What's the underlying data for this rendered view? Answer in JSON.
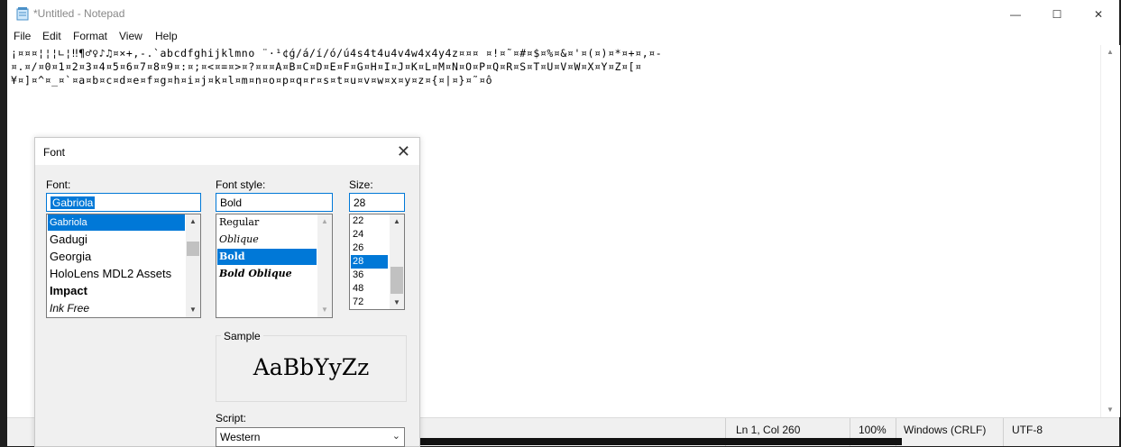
{
  "window": {
    "title": "*Untitled - Notepad",
    "buttons": {
      "minimize": "—",
      "maximize": "☐",
      "close": "✕"
    }
  },
  "menu": [
    "File",
    "Edit",
    "Format",
    "View",
    "Help"
  ],
  "editor": {
    "lines": [
      "¡¤¤¤¦¦¦∟¦‼¶♂♀♪♫¤×+,-.`abcdfghijklmno ¨·¹¢ǵ/á/í/ó/ú4s4t4u4v4w4x4y4z¤¤¤ ¤!¤˜¤#¤$¤%¤&¤'¤(¤)¤*¤+¤,¤-",
      "¤.¤/¤0¤1¤2¤3¤4¤5¤6¤7¤8¤9¤:¤;¤<¤=¤>¤?¤¤¤A¤B¤C¤D¤E¤F¤G¤H¤I¤J¤K¤L¤M¤N¤O¤P¤Q¤R¤S¤T¤U¤V¤W¤X¤Y¤Z¤[¤",
      "¥¤]¤^¤_¤`¤a¤b¤c¤d¤e¤f¤g¤h¤i¤j¤k¤l¤m¤n¤o¤p¤q¤r¤s¤t¤u¤v¤w¤x¤y¤z¤{¤|¤}¤˜¤ô"
    ]
  },
  "status": {
    "position": "Ln 1, Col 260",
    "zoom": "100%",
    "line_ending": "Windows (CRLF)",
    "encoding": "UTF-8"
  },
  "dialog": {
    "title": "Font",
    "font_label": "Font:",
    "font_value": "Gabriola",
    "fonts": [
      "Gabriola",
      "Gadugi",
      "Georgia",
      "HoloLens MDL2 Assets",
      "Impact",
      "Ink Free"
    ],
    "style_label": "Font style:",
    "style_value": "Bold",
    "styles": [
      "Regular",
      "Oblique",
      "Bold",
      "Bold Oblique"
    ],
    "size_label": "Size:",
    "size_value": "28",
    "sizes": [
      "22",
      "24",
      "26",
      "28",
      "36",
      "48",
      "72"
    ],
    "sample_label": "Sample",
    "sample_text": "AaBbYyZz",
    "script_label": "Script:",
    "script_value": "Western"
  },
  "icons": {
    "notepad": "notepad-icon",
    "close": "close-icon",
    "chevron": "chevron-down-icon"
  }
}
